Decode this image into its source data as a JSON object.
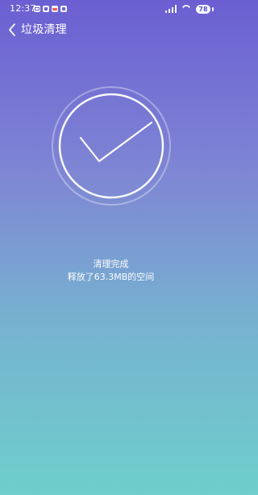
{
  "status_bar": {
    "time": "12:37",
    "battery_level": "78",
    "icons": [
      "mail-icon",
      "square-icon",
      "photo-icon",
      "message-icon",
      "signal-icon",
      "wifi-icon",
      "battery-icon"
    ]
  },
  "header": {
    "title": "垃圾清理",
    "back_icon": "chevron-left-icon"
  },
  "success": {
    "icon": "check-icon",
    "status_text": "清理完成",
    "freed_text": "释放了63.3MB的空间"
  },
  "colors": {
    "gradient_top": "#6a5fd2",
    "gradient_mid": "#7f86d4",
    "gradient_bottom": "#6ecfcb"
  }
}
